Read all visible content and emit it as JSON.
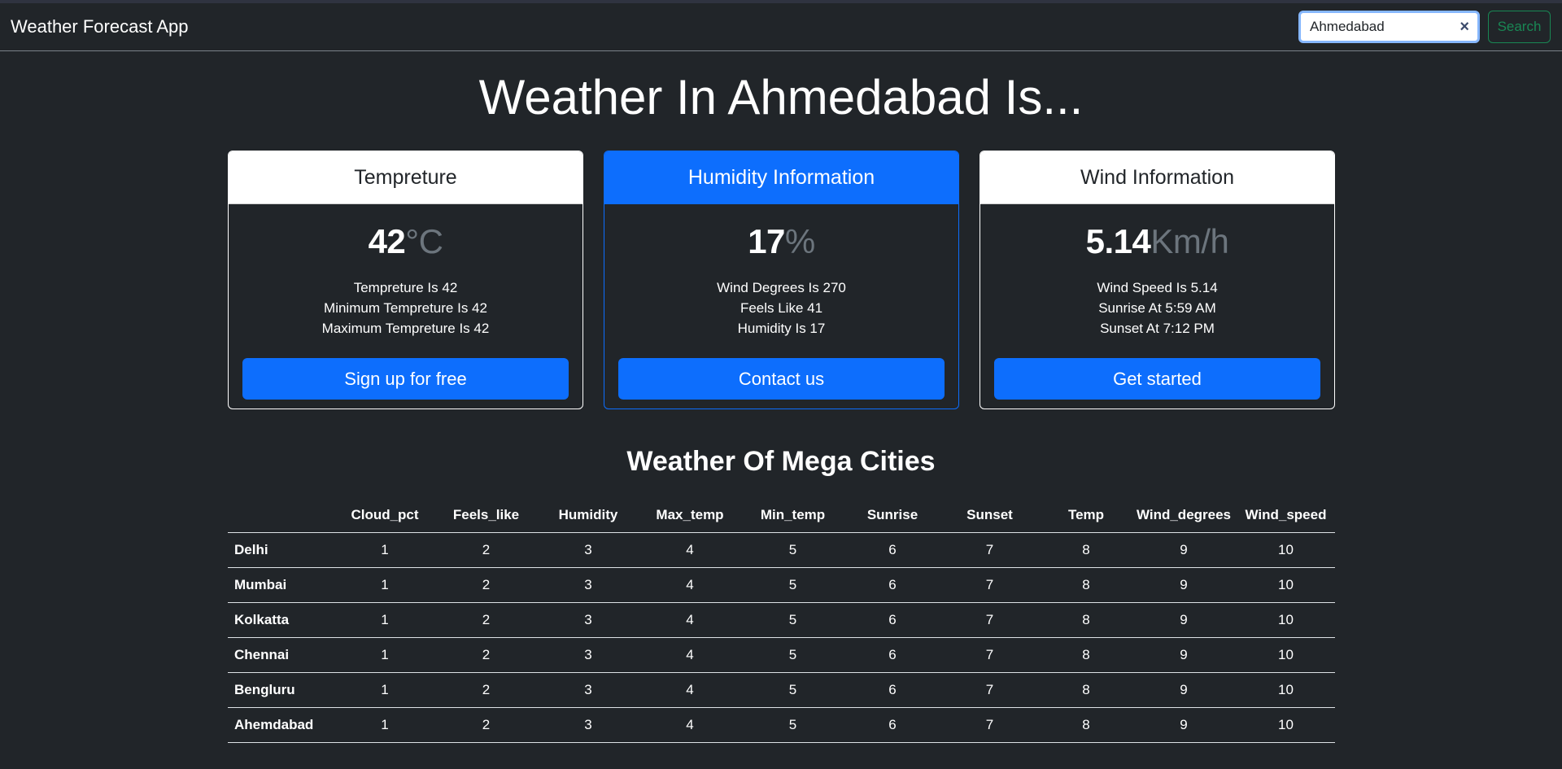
{
  "navbar": {
    "brand": "Weather Forecast App",
    "search_value": "Ahmedabad",
    "search_button": "Search",
    "clear_icon": "×"
  },
  "page_title": "Weather In Ahmedabad Is...",
  "cards": [
    {
      "header": "Tempreture",
      "value": "42",
      "unit": "°C",
      "lines": [
        "Tempreture Is 42",
        "Minimum Tempreture Is 42",
        "Maximum Tempreture Is 42"
      ],
      "button": "Sign up for free"
    },
    {
      "header": "Humidity Information",
      "value": "17",
      "unit": "%",
      "lines": [
        "Wind Degrees Is 270",
        "Feels Like 41",
        "Humidity Is 17"
      ],
      "button": "Contact us"
    },
    {
      "header": "Wind Information",
      "value": "5.14",
      "unit": "Km/h",
      "lines": [
        "Wind Speed Is 5.14",
        "Sunrise At 5:59 AM",
        "Sunset At 7:12 PM"
      ],
      "button": "Get started"
    }
  ],
  "table": {
    "title": "Weather Of Mega Cities",
    "columns": [
      "",
      "Cloud_pct",
      "Feels_like",
      "Humidity",
      "Max_temp",
      "Min_temp",
      "Sunrise",
      "Sunset",
      "Temp",
      "Wind_degrees",
      "Wind_speed"
    ],
    "rows": [
      {
        "city": "Delhi",
        "values": [
          "1",
          "2",
          "3",
          "4",
          "5",
          "6",
          "7",
          "8",
          "9",
          "10"
        ]
      },
      {
        "city": "Mumbai",
        "values": [
          "1",
          "2",
          "3",
          "4",
          "5",
          "6",
          "7",
          "8",
          "9",
          "10"
        ]
      },
      {
        "city": "Kolkatta",
        "values": [
          "1",
          "2",
          "3",
          "4",
          "5",
          "6",
          "7",
          "8",
          "9",
          "10"
        ]
      },
      {
        "city": "Chennai",
        "values": [
          "1",
          "2",
          "3",
          "4",
          "5",
          "6",
          "7",
          "8",
          "9",
          "10"
        ]
      },
      {
        "city": "Bengluru",
        "values": [
          "1",
          "2",
          "3",
          "4",
          "5",
          "6",
          "7",
          "8",
          "9",
          "10"
        ]
      },
      {
        "city": "Ahemdabad",
        "values": [
          "1",
          "2",
          "3",
          "4",
          "5",
          "6",
          "7",
          "8",
          "9",
          "10"
        ]
      }
    ]
  },
  "colors": {
    "background": "#212529",
    "primary": "#0d6efd",
    "success": "#198754",
    "muted": "#6c757d"
  }
}
